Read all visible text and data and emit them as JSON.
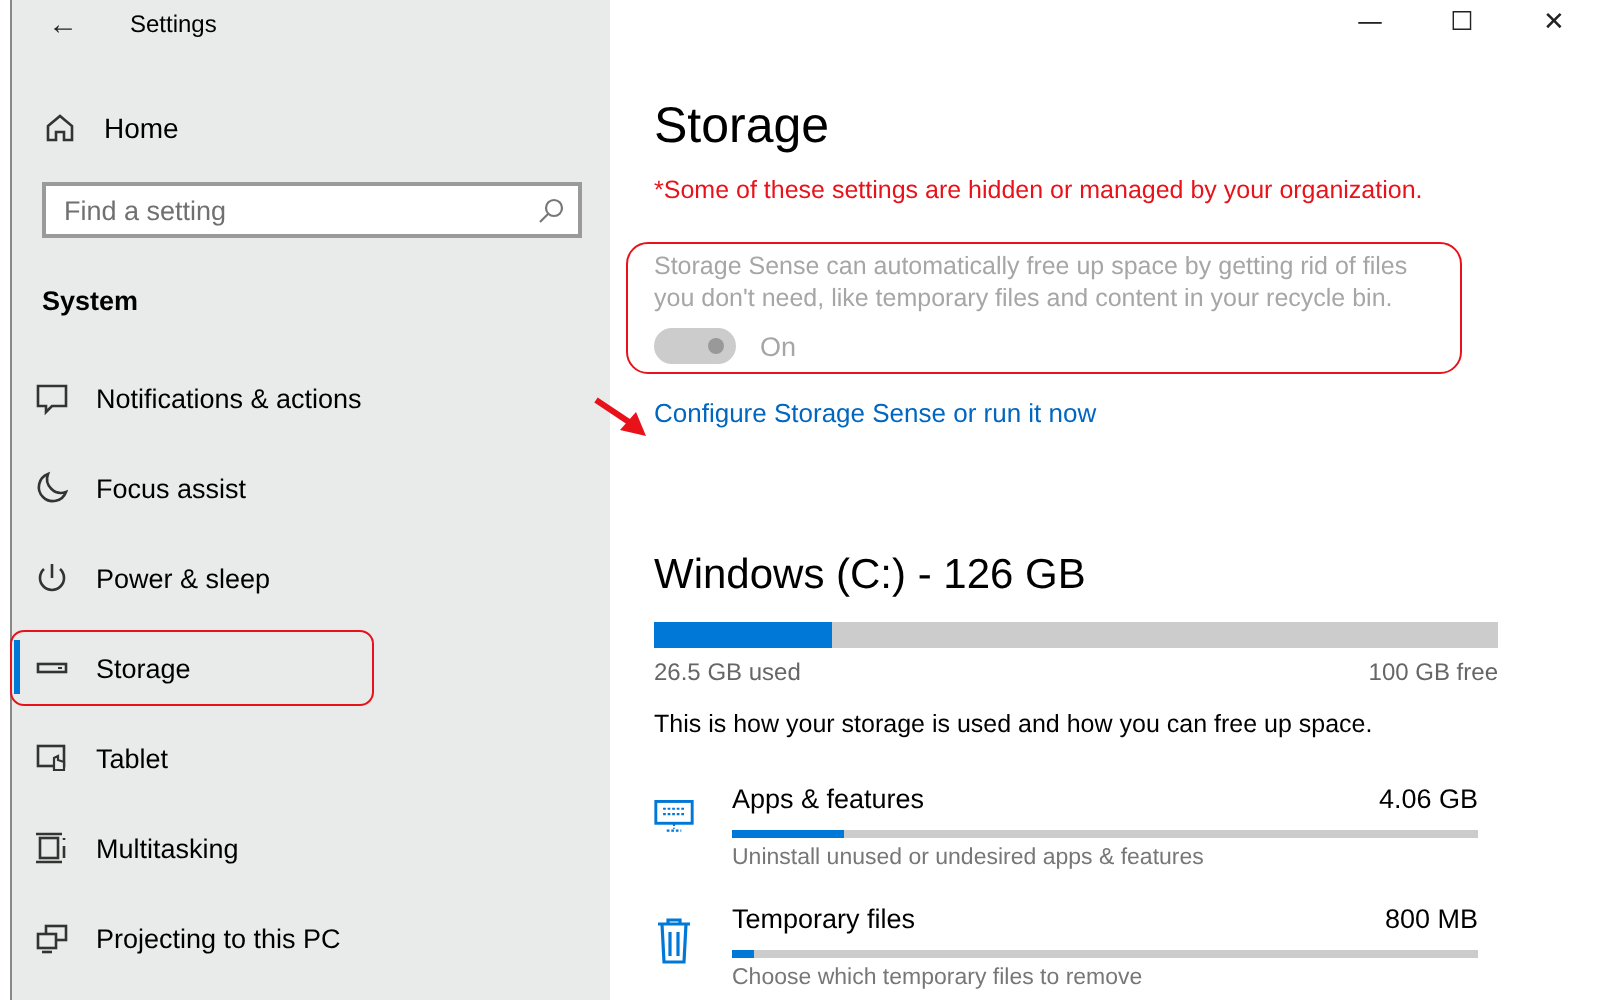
{
  "window": {
    "title": "Settings",
    "back": "←",
    "controls": [
      "—",
      "☐",
      "✕"
    ]
  },
  "sidebar": {
    "home": "Home",
    "search": {
      "placeholder": "Find a setting"
    },
    "section": "System",
    "items": [
      {
        "label": "Notifications & actions",
        "kind": "notifications",
        "selected": false,
        "annotated": false
      },
      {
        "label": "Focus assist",
        "kind": "focus",
        "selected": false,
        "annotated": false
      },
      {
        "label": "Power & sleep",
        "kind": "power",
        "selected": false,
        "annotated": false
      },
      {
        "label": "Storage",
        "kind": "storage",
        "selected": true,
        "annotated": true
      },
      {
        "label": "Tablet",
        "kind": "tablet",
        "selected": false,
        "annotated": false
      },
      {
        "label": "Multitasking",
        "kind": "multitasking",
        "selected": false,
        "annotated": false
      },
      {
        "label": "Projecting to this PC",
        "kind": "projecting",
        "selected": false,
        "annotated": false
      }
    ]
  },
  "page": {
    "title": "Storage",
    "warning": "*Some of these settings are hidden or managed by your organization.",
    "storage_sense": {
      "description": "Storage Sense can automatically free up space by getting rid of files you don't need, like temporary files and content in your recycle bin.",
      "on": true,
      "disabled": true,
      "toggle_label": "On",
      "annotated": true
    },
    "link": "Configure Storage Sense or run it now",
    "link_arrow": true,
    "drive": {
      "title": "Windows (C:) - 126 GB",
      "level": 0.21,
      "used": "26.5 GB used",
      "free": "100 GB free"
    },
    "intro": "This is how your storage is used and how you can free up space.",
    "categories": [
      {
        "kind": "apps",
        "name": "Apps & features",
        "size": "4.06 GB",
        "level": 0.15,
        "hint": "Uninstall unused or undesired apps & features"
      },
      {
        "kind": "temp",
        "name": "Temporary files",
        "size": "800 MB",
        "level": 0.03,
        "hint": "Choose which temporary files to remove"
      }
    ]
  }
}
